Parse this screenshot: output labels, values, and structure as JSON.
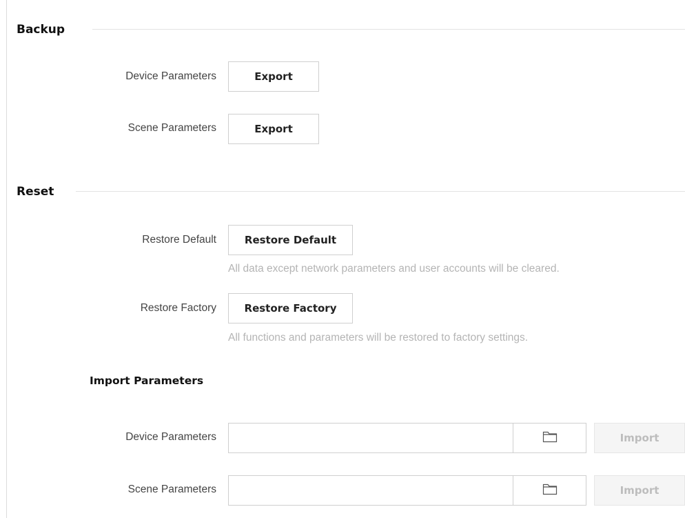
{
  "backup": {
    "title": "Backup",
    "device_label": "Device Parameters",
    "device_button": "Export",
    "scene_label": "Scene Parameters",
    "scene_button": "Export"
  },
  "reset": {
    "title": "Reset",
    "restore_default_label": "Restore Default",
    "restore_default_button": "Restore Default",
    "restore_default_hint": "All data except network parameters and user accounts will be cleared.",
    "restore_factory_label": "Restore Factory",
    "restore_factory_button": "Restore Factory",
    "restore_factory_hint": "All functions and parameters will be restored to factory settings."
  },
  "import": {
    "title": "Import Parameters",
    "device_label": "Device Parameters",
    "device_value": "",
    "device_button": "Import",
    "scene_label": "Scene Parameters",
    "scene_value": "",
    "scene_button": "Import",
    "browse_icon": "folder-icon"
  }
}
